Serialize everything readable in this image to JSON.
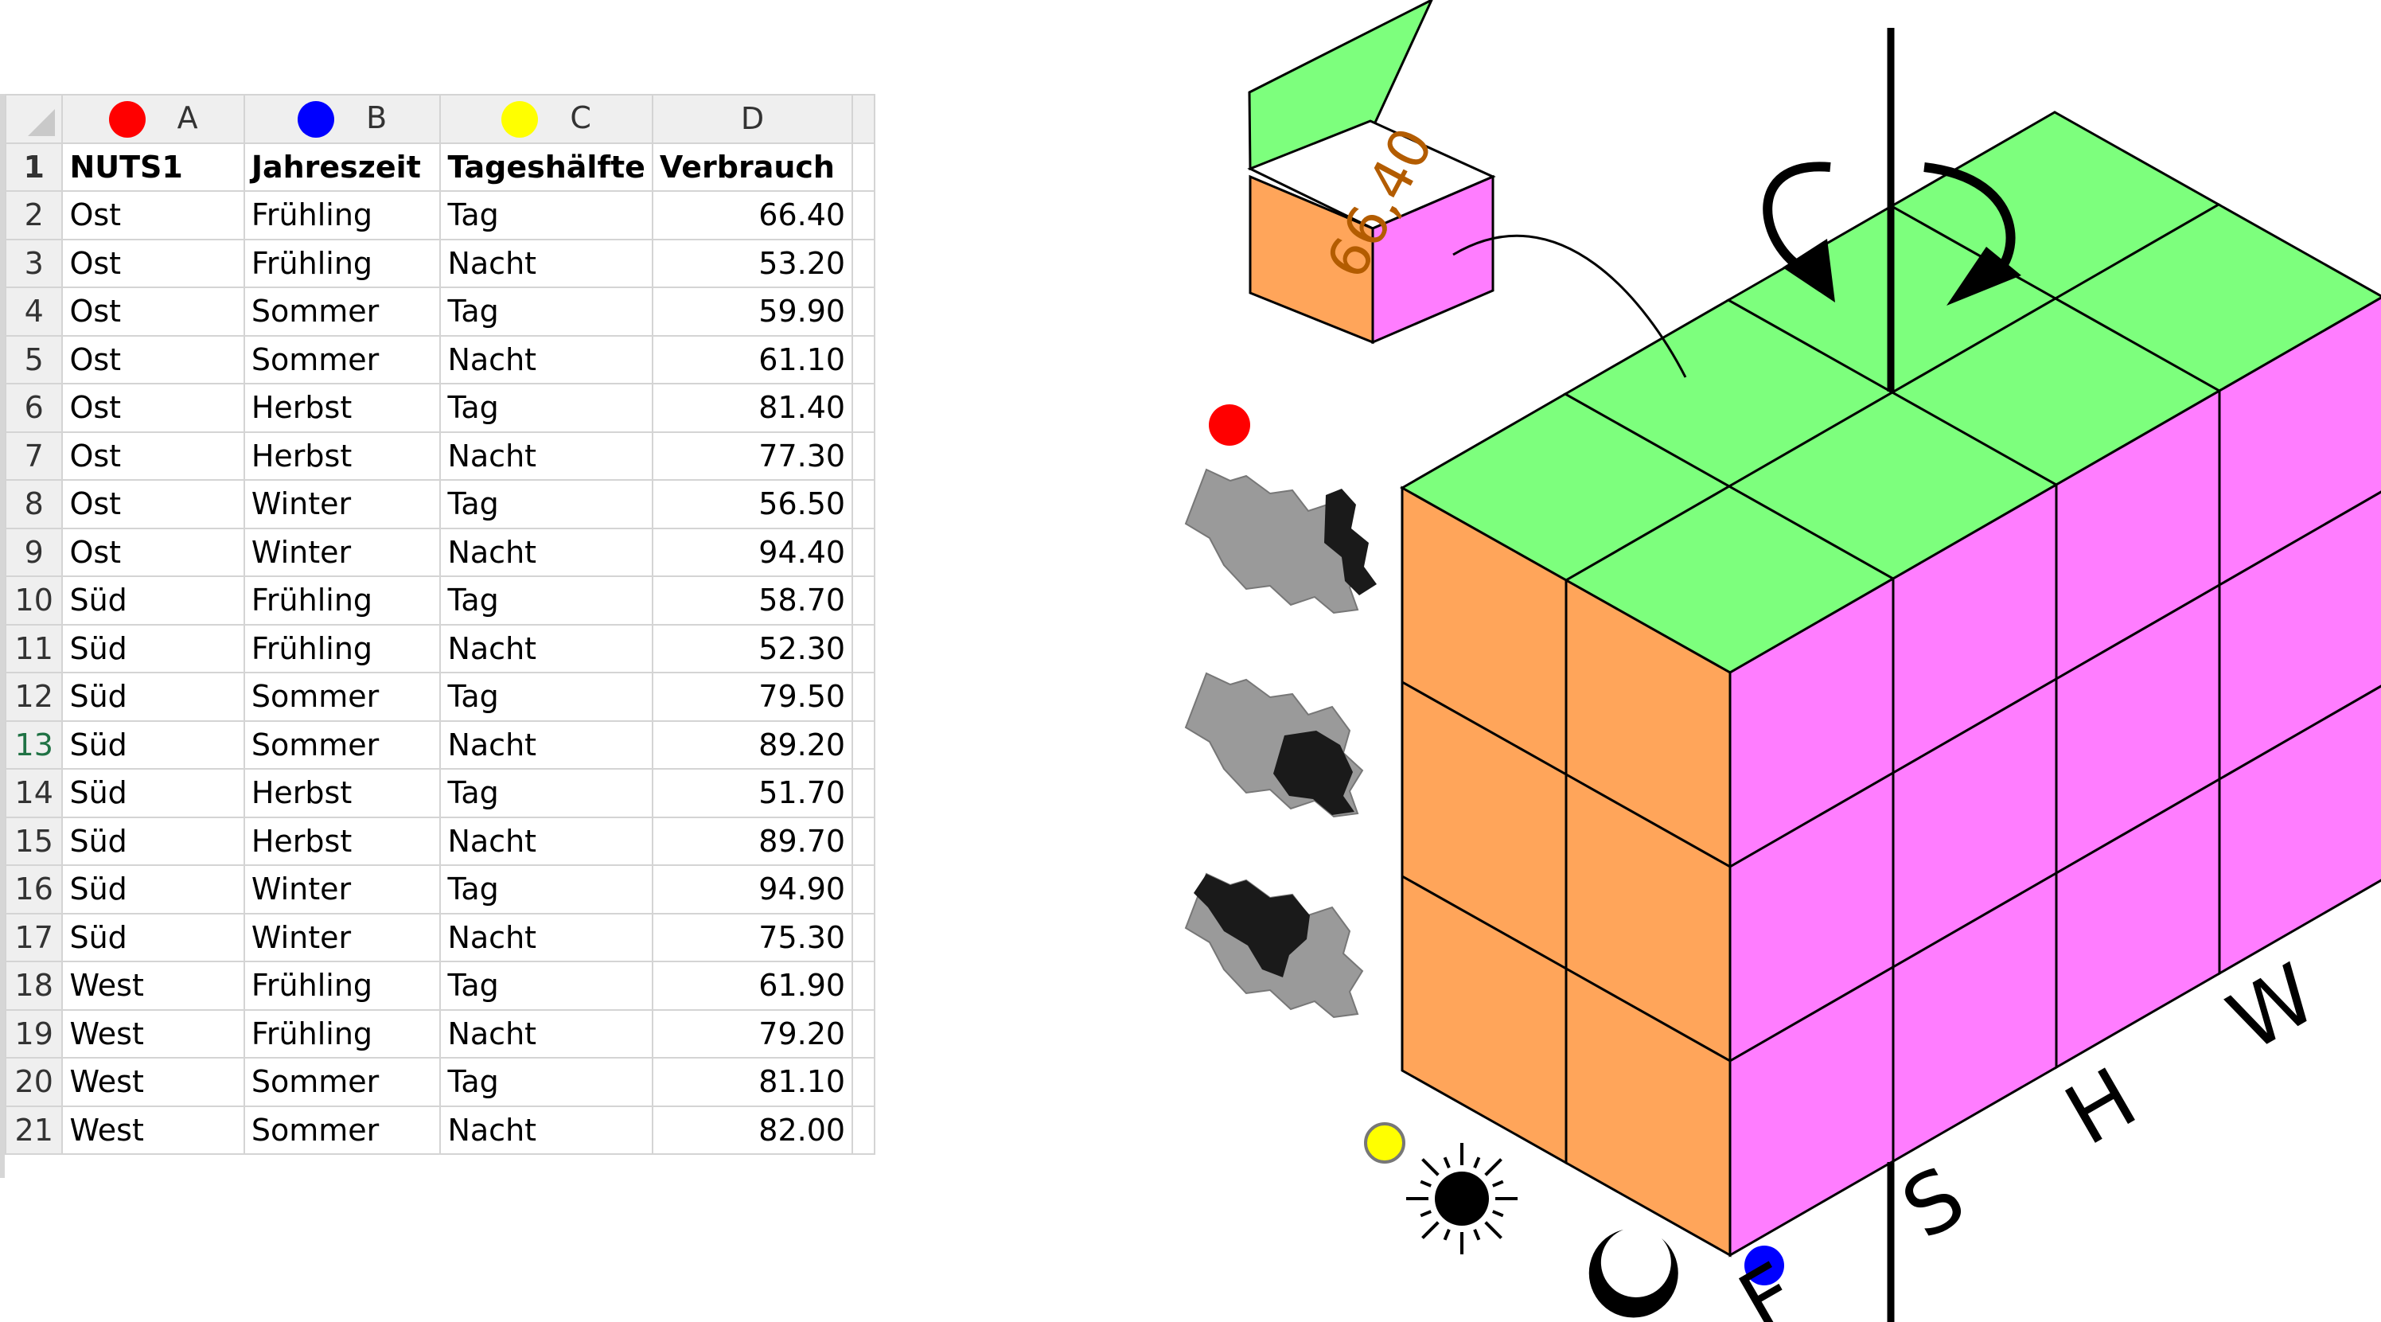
{
  "spreadsheet": {
    "columns": [
      {
        "letter": "A",
        "dot_color": "#ff0000"
      },
      {
        "letter": "B",
        "dot_color": "#0000ff"
      },
      {
        "letter": "C",
        "dot_color": "#ffff00"
      },
      {
        "letter": "D",
        "dot_color": ""
      }
    ],
    "header": [
      "NUTS1",
      "Jahreszeit",
      "Tageshälfte",
      "Verbrauch"
    ],
    "rows": [
      [
        "Ost",
        "Frühling",
        "Tag",
        "66.40"
      ],
      [
        "Ost",
        "Frühling",
        "Nacht",
        "53.20"
      ],
      [
        "Ost",
        "Sommer",
        "Tag",
        "59.90"
      ],
      [
        "Ost",
        "Sommer",
        "Nacht",
        "61.10"
      ],
      [
        "Ost",
        "Herbst",
        "Tag",
        "81.40"
      ],
      [
        "Ost",
        "Herbst",
        "Nacht",
        "77.30"
      ],
      [
        "Ost",
        "Winter",
        "Tag",
        "56.50"
      ],
      [
        "Ost",
        "Winter",
        "Nacht",
        "94.40"
      ],
      [
        "Süd",
        "Frühling",
        "Tag",
        "58.70"
      ],
      [
        "Süd",
        "Frühling",
        "Nacht",
        "52.30"
      ],
      [
        "Süd",
        "Sommer",
        "Tag",
        "79.50"
      ],
      [
        "Süd",
        "Sommer",
        "Nacht",
        "89.20"
      ],
      [
        "Süd",
        "Herbst",
        "Tag",
        "51.70"
      ],
      [
        "Süd",
        "Herbst",
        "Nacht",
        "89.70"
      ],
      [
        "Süd",
        "Winter",
        "Tag",
        "94.90"
      ],
      [
        "Süd",
        "Winter",
        "Nacht",
        "75.30"
      ],
      [
        "West",
        "Frühling",
        "Tag",
        "61.90"
      ],
      [
        "West",
        "Frühling",
        "Nacht",
        "79.20"
      ],
      [
        "West",
        "Sommer",
        "Tag",
        "81.10"
      ],
      [
        "West",
        "Sommer",
        "Nacht",
        "82.00"
      ]
    ],
    "row_numbers": [
      "1",
      "2",
      "3",
      "4",
      "5",
      "6",
      "7",
      "8",
      "9",
      "10",
      "11",
      "12",
      "13",
      "14",
      "15",
      "16",
      "17",
      "18",
      "19",
      "20",
      "21"
    ],
    "selected_row_number": "13"
  },
  "cube": {
    "detail_value": "66,40",
    "season_labels": [
      "F",
      "S",
      "H",
      "W"
    ],
    "colors": {
      "top": "#7dff7d",
      "front": "#ffa55a",
      "side": "#ff7dff",
      "region_dot": "#ff0000",
      "season_dot": "#0000ff",
      "dayhalf_dot": "#ffff00"
    },
    "icons": [
      "region-map-icon",
      "sun-icon",
      "moon-icon",
      "rotate-arrows-icon"
    ]
  }
}
